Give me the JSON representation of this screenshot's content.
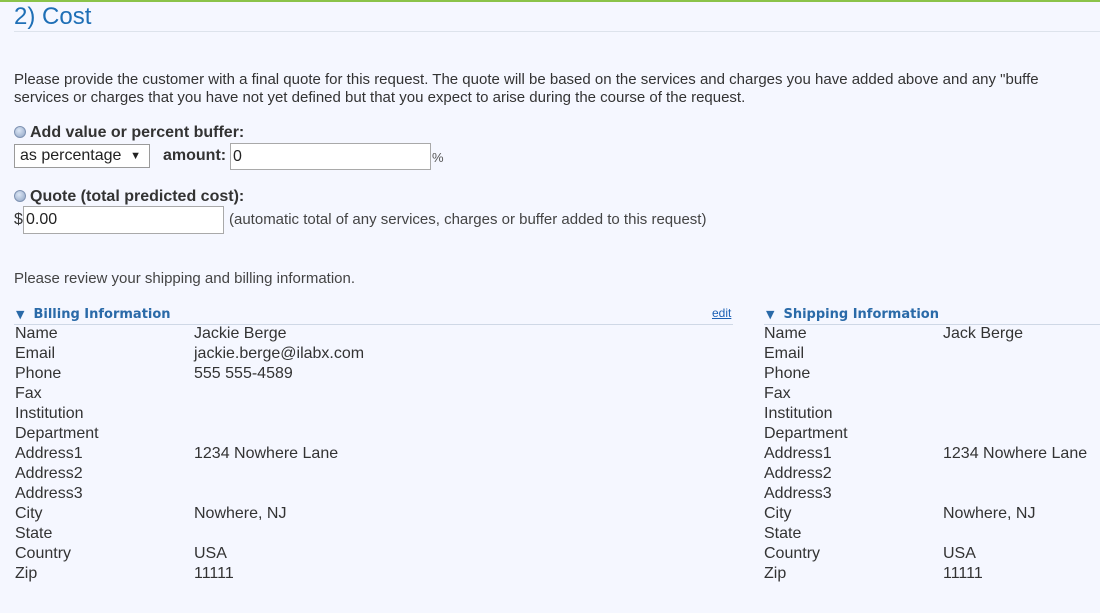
{
  "section": {
    "title": "2) Cost",
    "intro_line1": "Please provide the customer with a final quote for this request. The quote will be based on the services and charges you have added above and any \"buffe",
    "intro_line2": "services or charges that you have not yet defined but that you expect to arise during the course of the request."
  },
  "buffer": {
    "label": "Add value or percent buffer:",
    "mode_selected": "as percentage",
    "amount_label": "amount:",
    "amount_value": "0",
    "unit": "%"
  },
  "quote": {
    "label": "Quote (total predicted cost):",
    "currency": "$",
    "value": "0.00",
    "note": "(automatic total of any services, charges or buffer added to this request)"
  },
  "review_text": "Please review your shipping and billing information.",
  "billing": {
    "title": "Billing Information",
    "edit_label": "edit",
    "rows": [
      {
        "label": "Name",
        "value": "Jackie Berge"
      },
      {
        "label": "Email",
        "value": "jackie.berge@ilabx.com"
      },
      {
        "label": "Phone",
        "value": "555 555-4589"
      },
      {
        "label": "Fax",
        "value": ""
      },
      {
        "label": "Institution",
        "value": ""
      },
      {
        "label": "Department",
        "value": ""
      },
      {
        "label": "Address1",
        "value": "1234 Nowhere Lane"
      },
      {
        "label": "Address2",
        "value": ""
      },
      {
        "label": "Address3",
        "value": ""
      },
      {
        "label": "City",
        "value": "Nowhere, NJ"
      },
      {
        "label": "State",
        "value": ""
      },
      {
        "label": "Country",
        "value": "USA"
      },
      {
        "label": "Zip",
        "value": "11111"
      }
    ]
  },
  "shipping": {
    "title": "Shipping Information",
    "rows": [
      {
        "label": "Name",
        "value": "Jack Berge"
      },
      {
        "label": "Email",
        "value": ""
      },
      {
        "label": "Phone",
        "value": ""
      },
      {
        "label": "Fax",
        "value": ""
      },
      {
        "label": "Institution",
        "value": ""
      },
      {
        "label": "Department",
        "value": ""
      },
      {
        "label": "Address1",
        "value": "1234 Nowhere Lane"
      },
      {
        "label": "Address2",
        "value": ""
      },
      {
        "label": "Address3",
        "value": ""
      },
      {
        "label": "City",
        "value": "Nowhere, NJ"
      },
      {
        "label": "State",
        "value": ""
      },
      {
        "label": "Country",
        "value": "USA"
      },
      {
        "label": "Zip",
        "value": "11111"
      }
    ]
  },
  "colors": {
    "accent": "#1e6fb6",
    "top_bar": "#8bc34a",
    "background": "#f5f7ff"
  }
}
